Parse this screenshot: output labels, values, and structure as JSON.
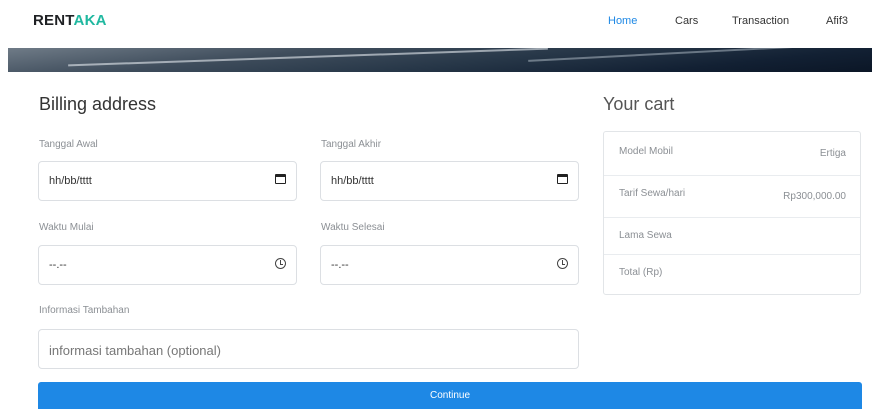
{
  "brand": {
    "part1": "RENT",
    "part2": "AKA"
  },
  "nav": [
    {
      "label": "Home",
      "active": true
    },
    {
      "label": "Cars",
      "active": false
    },
    {
      "label": "Transaction",
      "active": false
    },
    {
      "label": "Afif3",
      "active": false
    }
  ],
  "billing": {
    "title": "Billing address",
    "start_date": {
      "label": "Tanggal Awal",
      "value": "hh/bb/tttt"
    },
    "end_date": {
      "label": "Tanggal Akhir",
      "value": "hh/bb/tttt"
    },
    "start_time": {
      "label": "Waktu Mulai",
      "value": "--.--"
    },
    "end_time": {
      "label": "Waktu Selesai",
      "value": "--.--"
    },
    "extra": {
      "label": "Informasi Tambahan",
      "placeholder": "informasi tambahan (optional)"
    },
    "continue_label": "Continue"
  },
  "cart": {
    "title": "Your cart",
    "rows": [
      {
        "key": "Model Mobil",
        "value": "Ertiga"
      },
      {
        "key": "Tarif Sewa/hari",
        "value": "Rp300,000.00"
      },
      {
        "key": "Lama Sewa",
        "value": ""
      },
      {
        "key": "Total (Rp)",
        "value": ""
      }
    ]
  },
  "colors": {
    "accent": "#1e88e5",
    "brand_accent": "#20b8a0"
  }
}
